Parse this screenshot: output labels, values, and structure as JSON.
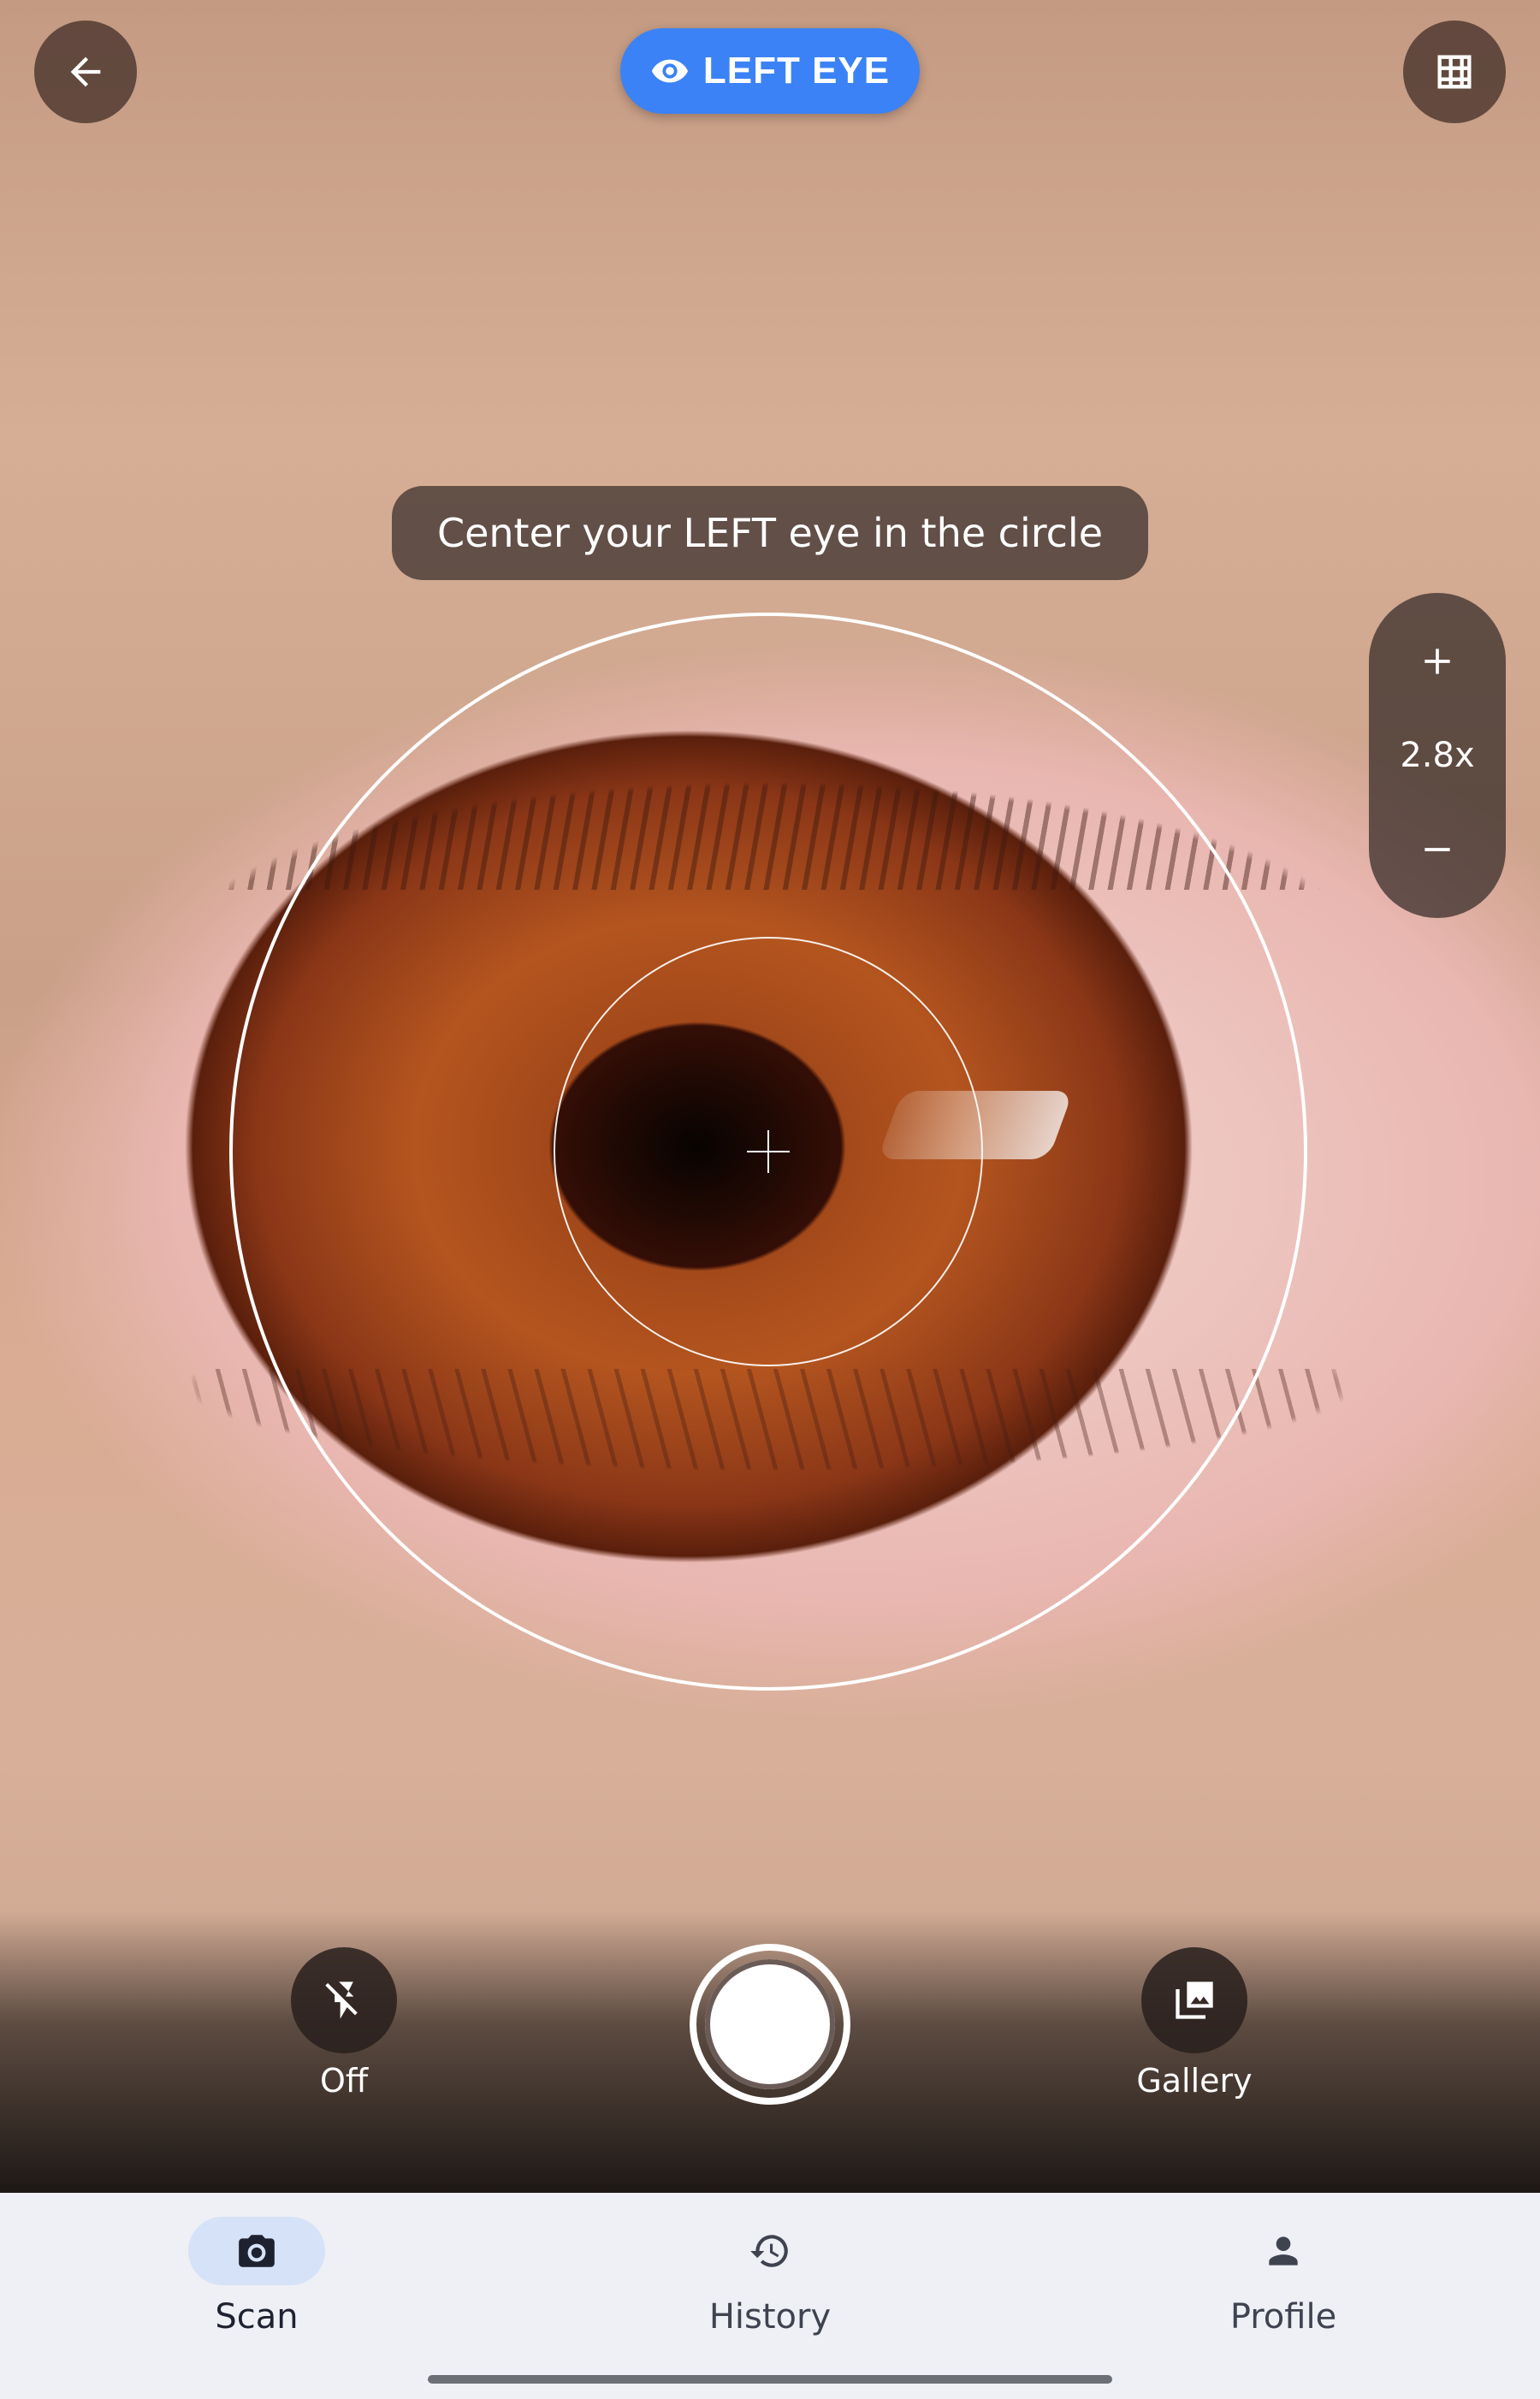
{
  "header": {
    "eye_chip_label": "LEFT EYE",
    "icons": {
      "back": "arrow-left-icon",
      "grid": "grid-icon",
      "eye": "eye-icon"
    }
  },
  "instruction": "Center your LEFT eye in the circle",
  "zoom": {
    "level": "2.8x",
    "icons": {
      "in": "plus-icon",
      "out": "minus-icon"
    }
  },
  "capture": {
    "flash_label": "Off",
    "gallery_label": "Gallery",
    "icons": {
      "flash": "flash-off-icon",
      "gallery": "gallery-icon",
      "shutter": "shutter-button"
    }
  },
  "nav": {
    "items": [
      {
        "label": "Scan",
        "icon": "camera-icon",
        "active": true
      },
      {
        "label": "History",
        "icon": "history-icon",
        "active": false
      },
      {
        "label": "Profile",
        "icon": "person-icon",
        "active": false
      }
    ]
  },
  "colors": {
    "accent": "#3b82f6",
    "nav_background": "#eef0f5",
    "active_pill": "#d6e2f7"
  }
}
